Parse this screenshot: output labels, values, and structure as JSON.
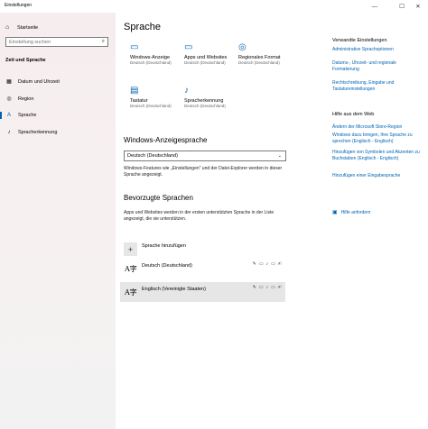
{
  "window": {
    "title": "Einstellungen",
    "minimize": "—",
    "maximize": "☐",
    "close": "✕"
  },
  "sidebar": {
    "home_label": "Startseite",
    "search_placeholder": "Einstellung suchen",
    "section": "Zeit und Sprache",
    "items": [
      {
        "label": "Datum und Uhrzeit",
        "icon": "calendar-clock-icon"
      },
      {
        "label": "Region",
        "icon": "globe-icon"
      },
      {
        "label": "Sprache",
        "icon": "language-icon",
        "active": true
      },
      {
        "label": "Spracherkennung",
        "icon": "microphone-icon"
      }
    ]
  },
  "main": {
    "title": "Sprache",
    "tiles": [
      {
        "label": "Windows-Anzeige",
        "sub": "Deutsch (Deutschland)",
        "icon": "monitor-icon"
      },
      {
        "label": "Apps und Websites",
        "sub": "Deutsch (Deutschland)",
        "icon": "window-icon"
      },
      {
        "label": "Regionales Format",
        "sub": "Deutsch (Deutschland)",
        "icon": "globe-icon"
      },
      {
        "label": "Tastatur",
        "sub": "Deutsch (Deutschland)",
        "icon": "keyboard-icon"
      },
      {
        "label": "Spracherkennung",
        "sub": "Deutsch (Deutschland)",
        "icon": "microphone-icon"
      }
    ],
    "display_language": {
      "heading": "Windows-Anzeigesprache",
      "selected": "Deutsch (Deutschland)",
      "description": "Windows-Features wie „Einstellungen\" und der Datei-Explorer werden in dieser Sprache angezeigt."
    },
    "preferred": {
      "heading": "Bevorzugte Sprachen",
      "description": "Apps und Websites werden in der ersten unterstützten Sprache in der Liste angezeigt, die sie unterstützen.",
      "add_label": "Sprache hinzufügen",
      "languages": [
        {
          "name": "Deutsch (Deutschland)"
        },
        {
          "name": "Englisch (Vereinigte Staaten)"
        }
      ]
    }
  },
  "related": {
    "title": "Verwandte Einstellungen",
    "links": [
      "Administrative Sprachoptionen",
      "Datums-, Uhrzeit- und regionale Formatierung",
      "Rechtschreibung, Eingabe und Tastatureinstellungen"
    ],
    "help_title": "Hilfe aus dem Web",
    "help_links": [
      "Ändern der Microsoft Store-Region",
      "Windows dazu bringen, Ihre Sprache zu sprechen (Englisch - Englisch)",
      "Hinzufügen von Symbolen und Akzenten zu Buchstaben (Englisch - Englisch)",
      "Hinzufügen einer Eingabesprache"
    ],
    "get_help": "Hilfe anfordern"
  },
  "colors": {
    "accent": "#0063b1",
    "sidebar_bg": "#f6eeee",
    "selected_row": "#e6e6e6"
  }
}
